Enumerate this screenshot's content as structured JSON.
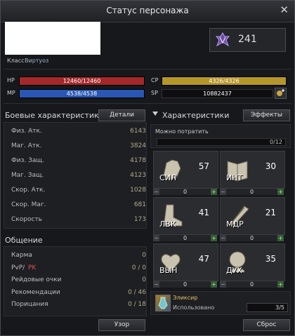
{
  "window": {
    "title": "Статус персонажа"
  },
  "profile": {
    "class_label": "Класс",
    "class_value": "Виртуоз",
    "level": "241"
  },
  "bars": {
    "hp": {
      "label": "HP",
      "text": "12460/12460",
      "fill": 1.0,
      "color": "#a4282a"
    },
    "mp": {
      "label": "MP",
      "text": "4538/4538",
      "fill": 1.0,
      "color": "#2a57b4"
    },
    "cp": {
      "label": "CP",
      "text": "4326/4326",
      "fill": 1.0,
      "color": "#b4962a"
    },
    "sp": {
      "label": "SP",
      "text": "10882437"
    }
  },
  "combat": {
    "title": "Боевые характеристики",
    "details_button": "Детали",
    "rows": [
      {
        "k": "Физ. Атк.",
        "v": "6143"
      },
      {
        "k": "Маг. Атк.",
        "v": "3824"
      },
      {
        "k": "Физ. Защ.",
        "v": "4178"
      },
      {
        "k": "Маг. Защ.",
        "v": "4123"
      },
      {
        "k": "Скор. Атк.",
        "v": "1028"
      },
      {
        "k": "Скор. Маг.",
        "v": "681"
      },
      {
        "k": "Скорость",
        "v": "173"
      }
    ]
  },
  "social": {
    "title": "Общение",
    "rows": [
      {
        "k": "Карма",
        "v": "0"
      },
      {
        "k": "PvP/",
        "k2": "PK",
        "v": "0 / 0"
      },
      {
        "k": "Рейдовые очки",
        "v": "0"
      },
      {
        "k": "Рекомендации",
        "v": "0 / 46"
      },
      {
        "k": "Порицания",
        "v": "0 / 18"
      }
    ]
  },
  "attributes": {
    "title": "Характеристики",
    "effects_button": "Эффекты",
    "spend_label": "Можно потратить",
    "spend_value": "0/12",
    "tiles": [
      {
        "name": "СИЛ",
        "value": "57",
        "add": "0",
        "icon": "fist-icon"
      },
      {
        "name": "ИНТ",
        "value": "30",
        "add": "0",
        "icon": "book-icon"
      },
      {
        "name": "ЛВК",
        "value": "41",
        "add": "0",
        "icon": "boot-icon"
      },
      {
        "name": "МДР",
        "value": "21",
        "add": "0",
        "icon": "feather-icon"
      },
      {
        "name": "ВЫН",
        "value": "47",
        "add": "0",
        "icon": "heart-icon"
      },
      {
        "name": "ДУХ",
        "value": "35",
        "add": "0",
        "icon": "head-icon"
      }
    ],
    "elixir": {
      "title": "Эликсир",
      "used_label": "Использовано",
      "used_value": "3/5"
    }
  },
  "footer": {
    "pattern_button": "Узор",
    "reset_button": "Сброс"
  }
}
